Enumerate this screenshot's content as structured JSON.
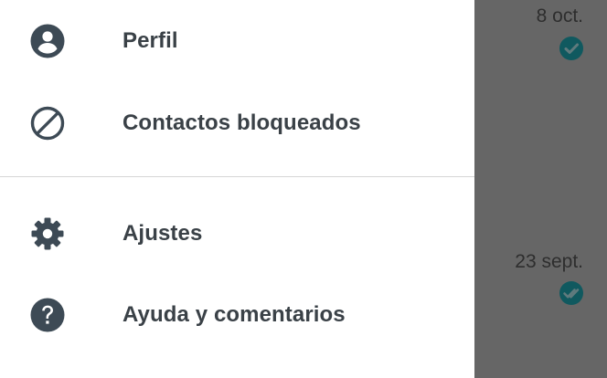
{
  "drawer": {
    "items": [
      {
        "label": "Perfil",
        "icon": "account-circle-icon"
      },
      {
        "label": "Contactos bloqueados",
        "icon": "block-icon"
      },
      {
        "label": "Ajustes",
        "icon": "gear-icon"
      },
      {
        "label": "Ayuda y comentarios",
        "icon": "help-icon"
      }
    ]
  },
  "background": {
    "conversations": [
      {
        "date": "8 oct.",
        "status": "read"
      },
      {
        "date": "23 sept.",
        "status": "read"
      }
    ]
  },
  "colors": {
    "drawer_bg": "#ffffff",
    "icon": "#3d4a55",
    "label": "#3a4147",
    "scrim": "#666666",
    "check_badge": "#10595f"
  }
}
